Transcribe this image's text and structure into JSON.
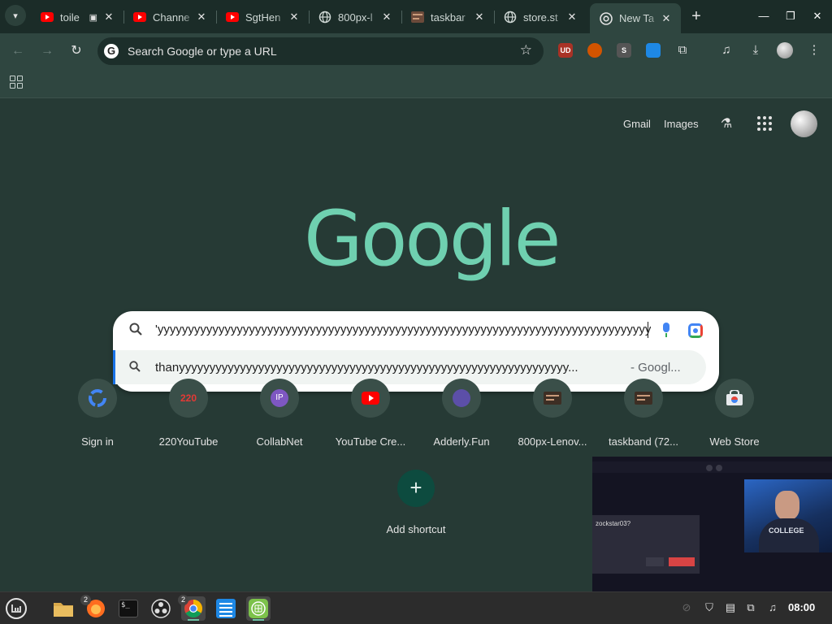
{
  "tabs": [
    {
      "title": "toile",
      "favicon": "youtube-icon",
      "active": false
    },
    {
      "title": "Channe",
      "favicon": "youtube-icon",
      "active": false
    },
    {
      "title": "SgtHen",
      "favicon": "youtube-icon",
      "active": false
    },
    {
      "title": "800px-l",
      "favicon": "globe-icon",
      "active": false
    },
    {
      "title": "taskbar",
      "favicon": "image-icon",
      "active": false
    },
    {
      "title": "store.st",
      "favicon": "globe-icon",
      "active": false
    },
    {
      "title": "New Ta",
      "favicon": "chrome-icon",
      "active": true
    }
  ],
  "toolbar": {
    "omnibox_placeholder": "Search Google or type a URL",
    "extensions": [
      {
        "name": "ublock",
        "label": "UD",
        "color": "#c0392b"
      },
      {
        "name": "cookie",
        "label": "",
        "color": "#d35400"
      },
      {
        "name": "s-ext",
        "label": "S",
        "color": "#5a5a5a"
      },
      {
        "name": "tab-ext",
        "label": "",
        "color": "#1e88e5"
      }
    ]
  },
  "ntp": {
    "gmail": "Gmail",
    "images": "Images",
    "logo": "Google",
    "query": "'yyyyyyyyyyyyyyyyyyyyyyyyyyyyyyyyyyyyyyyyyyyyyyyyyyyyyyyyyyyyyyyyyyyyyyyyyyyyyyyyy",
    "suggestion_text": "thanyyyyyyyyyyyyyyyyyyyyyyyyyyyyyyyyyyyyyyyyyyyyyyyyyyyyyyyyyyyyyyyy...",
    "suggestion_source": "- Googl...",
    "shortcuts": [
      {
        "label": "Sign in",
        "icon": "google-icon"
      },
      {
        "label": "220YouTube",
        "icon": "220-icon"
      },
      {
        "label": "CollabNet",
        "icon": "ip-icon"
      },
      {
        "label": "YouTube Cre...",
        "icon": "youtube-icon"
      },
      {
        "label": "Adderly.Fun",
        "icon": "adderly-icon"
      },
      {
        "label": "800px-Lenov...",
        "icon": "image-icon"
      },
      {
        "label": "taskband (72...",
        "icon": "image-icon"
      },
      {
        "label": "Web Store",
        "icon": "webstore-icon"
      }
    ],
    "add_shortcut": "Add shortcut"
  },
  "overlay": {
    "dialog_text": "zockstar03?",
    "shirt_text": "COLLEGE"
  },
  "taskbar": {
    "clock": "08:00",
    "badge_firefox": "2",
    "badge_chrome": "2"
  }
}
